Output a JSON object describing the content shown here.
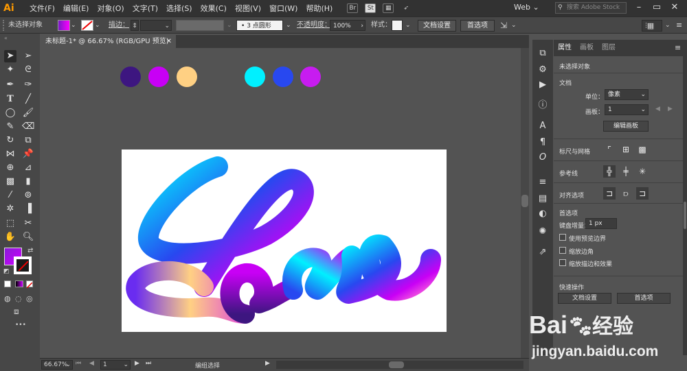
{
  "app": {
    "logo": "Ai"
  },
  "menubar": {
    "items": [
      "文件(F)",
      "编辑(E)",
      "对象(O)",
      "文字(T)",
      "选择(S)",
      "效果(C)",
      "视图(V)",
      "窗口(W)",
      "帮助(H)"
    ],
    "bridge_icon": "Br",
    "stock_icon": "St",
    "workspace": "Web",
    "search_placeholder": "搜索 Adobe Stock"
  },
  "controlbar": {
    "selection_label": "未选择对象",
    "stroke_label": "描边：",
    "brush_label": "3 点圆形",
    "opacity_label": "不透明度：",
    "opacity_value": "100%",
    "style_label": "样式：",
    "doc_setup": "文档设置",
    "preferences": "首选项"
  },
  "tools": {
    "fill_color": "#8a1cd6",
    "stroke_color": "#1a1a1a"
  },
  "document": {
    "tab_title": "未标题-1* @ 66.67% (RGB/GPU 预览)",
    "swatches": [
      "#3d1680",
      "#c800f5",
      "#ffd083",
      "#00f0ff",
      "#2848f0",
      "#c71cf0"
    ],
    "artwork_text": "Love"
  },
  "statusbar": {
    "zoom": "66.67%",
    "artboard_num": "1",
    "status_text": "编组选择"
  },
  "properties": {
    "tabs": [
      "属性",
      "画板",
      "图层"
    ],
    "no_selection": "未选择对象",
    "document_section": "文档",
    "units_label": "单位：",
    "units_value": "像素",
    "artboard_label": "画板：",
    "artboard_value": "1",
    "edit_artboards": "编辑画板",
    "rulers_grids": "标尺与网格",
    "guides": "参考线",
    "snap_options": "对齐选项",
    "preferences_section": "首选项",
    "keyboard_increment_label": "键盘增量：",
    "keyboard_increment_value": "1 px",
    "use_preview_bounds": "使用预览边界",
    "scale_corners": "缩放边角",
    "scale_strokes": "缩放描边和效果",
    "quick_actions": "快速操作",
    "qa_doc_setup": "文档设置",
    "qa_preferences": "首选项"
  },
  "watermark": {
    "brand": "Bai",
    "brand_suffix": "经验",
    "url": "jingyan.baidu.com"
  }
}
